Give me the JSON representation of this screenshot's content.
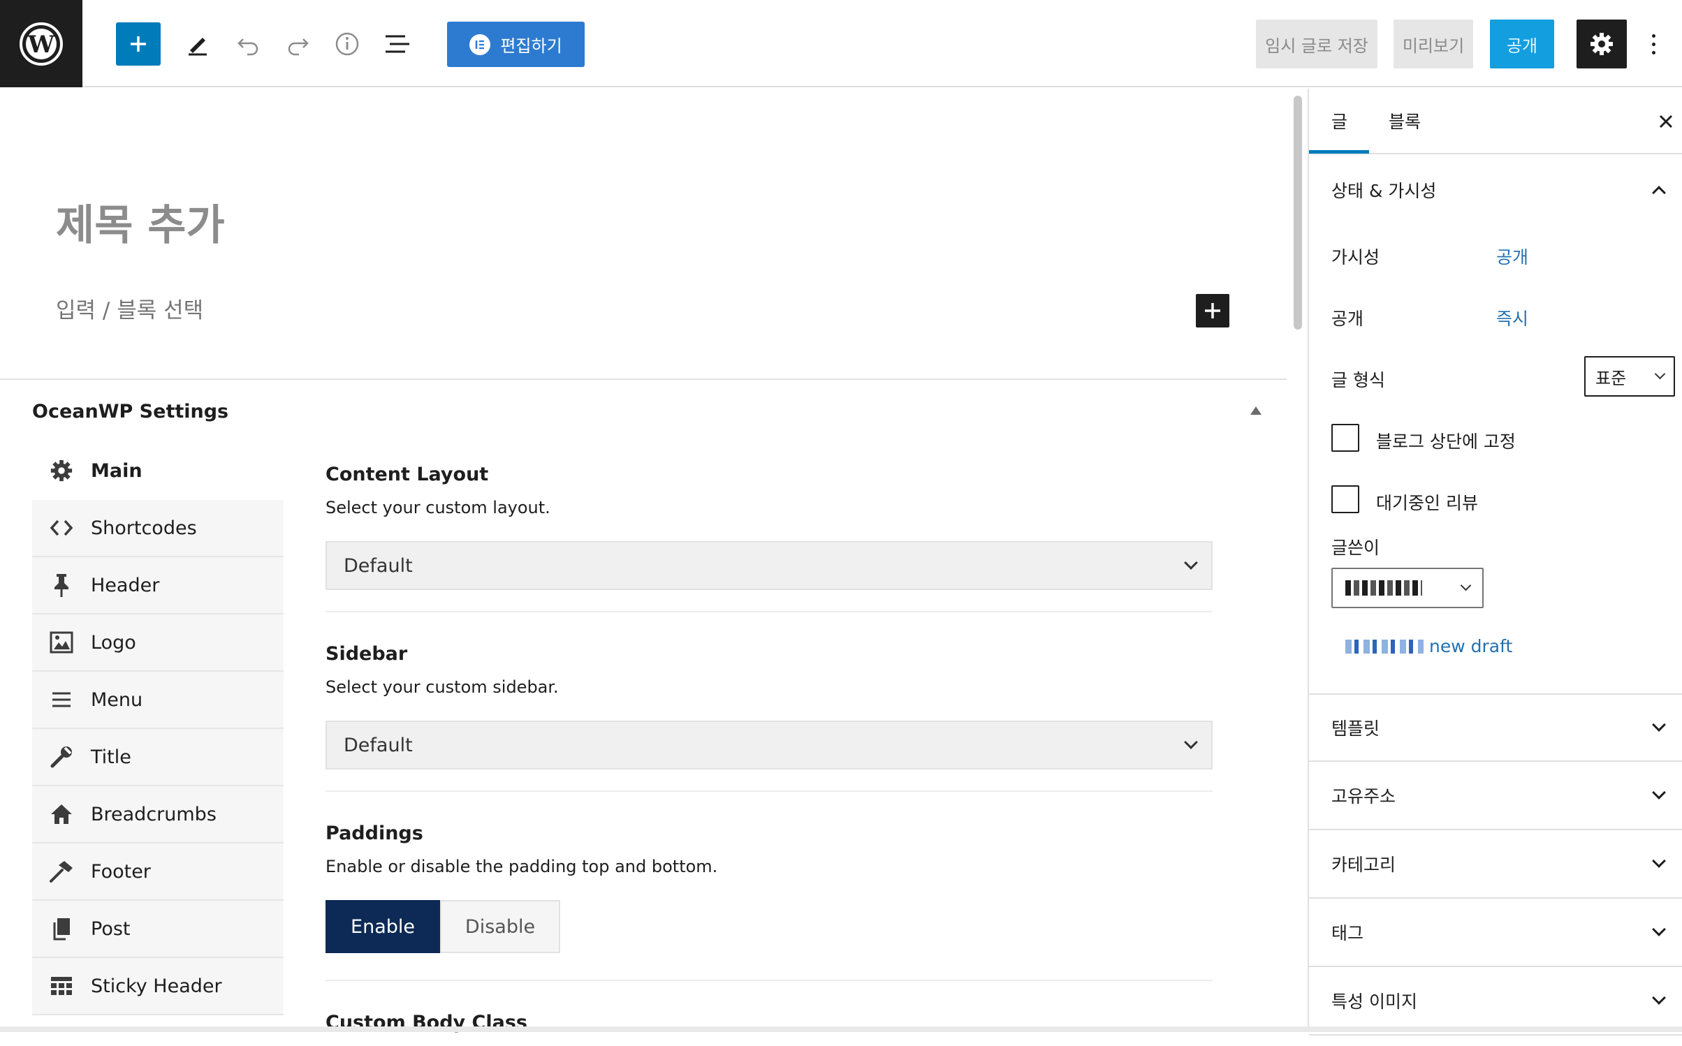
{
  "topbar": {
    "elementor_label": "편집하기",
    "save_draft_label": "임시 글로 저장",
    "preview_label": "미리보기",
    "publish_label": "공개"
  },
  "editor": {
    "title_placeholder": "제목 추가",
    "block_placeholder": "입력 / 블록 선택"
  },
  "metabox": {
    "title": "OceanWP Settings",
    "nav": [
      {
        "label": "Main",
        "icon": "gear-icon"
      },
      {
        "label": "Shortcodes",
        "icon": "code-icon"
      },
      {
        "label": "Header",
        "icon": "pin-icon"
      },
      {
        "label": "Logo",
        "icon": "image-icon"
      },
      {
        "label": "Menu",
        "icon": "menu-icon"
      },
      {
        "label": "Title",
        "icon": "wrench-icon"
      },
      {
        "label": "Breadcrumbs",
        "icon": "home-icon"
      },
      {
        "label": "Footer",
        "icon": "hammer-icon"
      },
      {
        "label": "Post",
        "icon": "copy-icon"
      },
      {
        "label": "Sticky Header",
        "icon": "table-icon"
      }
    ],
    "content_layout": {
      "title": "Content Layout",
      "desc": "Select your custom layout.",
      "value": "Default"
    },
    "sidebar": {
      "title": "Sidebar",
      "desc": "Select your custom sidebar.",
      "value": "Default"
    },
    "paddings": {
      "title": "Paddings",
      "desc": "Enable or disable the padding top and bottom.",
      "enable": "Enable",
      "disable": "Disable"
    },
    "custom_body_class": {
      "title": "Custom Body Class"
    }
  },
  "sidebar": {
    "tab_post": "글",
    "tab_block": "블록",
    "status_panel": "상태 & 가시성",
    "visibility_label": "가시성",
    "visibility_value": "공개",
    "publish_label": "공개",
    "publish_value": "즉시",
    "format_label": "글 형식",
    "format_value": "표준",
    "sticky_label": "블로그 상단에 고정",
    "pending_label": "대기중인 리뷰",
    "author_label": "글쓴이",
    "draft_link": "new draft",
    "panels": [
      "템플릿",
      "고유주소",
      "카테고리",
      "태그",
      "특성 이미지"
    ]
  }
}
